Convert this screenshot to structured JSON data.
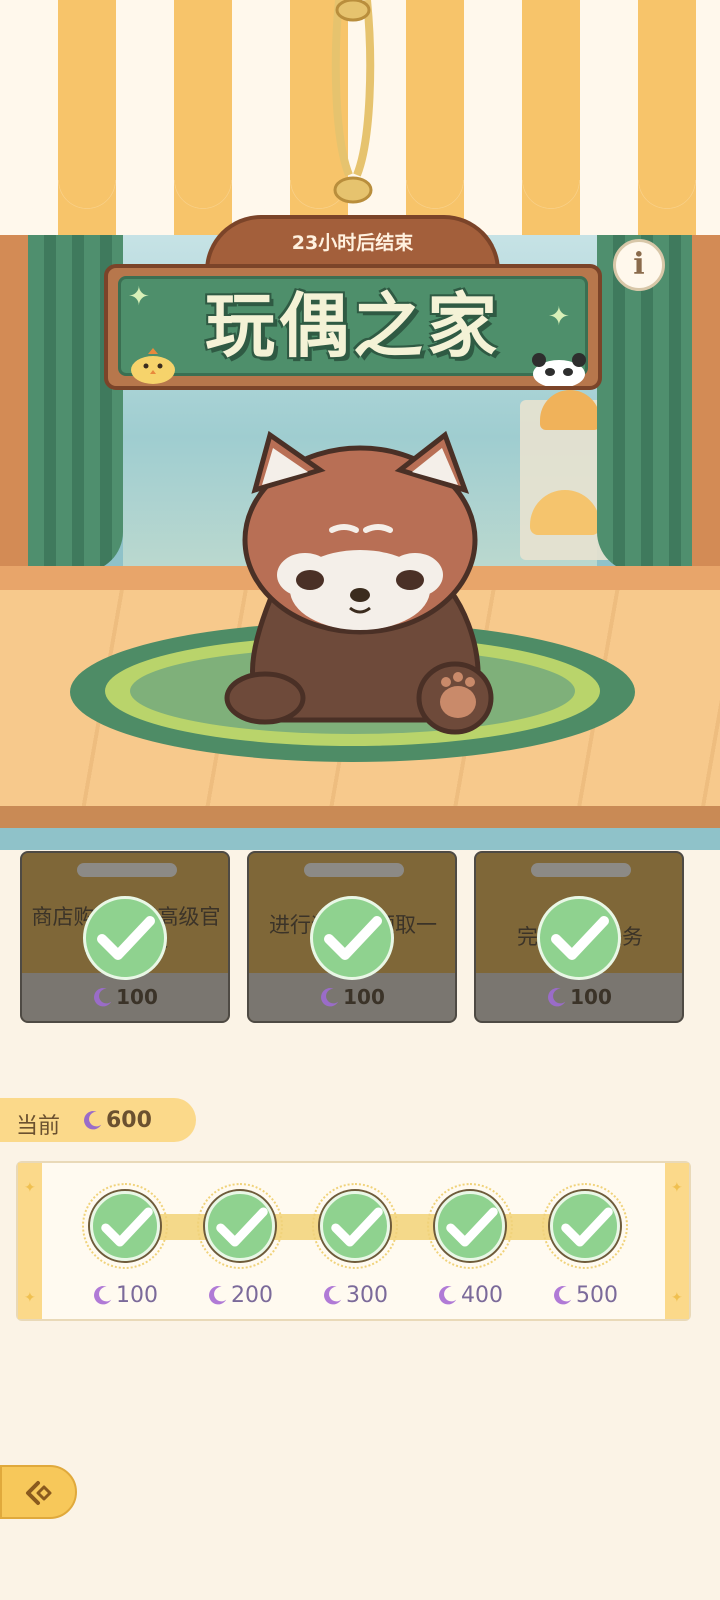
{
  "event": {
    "timer": "23小时后结束",
    "title": "玩偶之家",
    "info_icon": "info-icon"
  },
  "tasks": [
    {
      "text": "商店购买任意高级官方兑换券",
      "reward": "100",
      "completed": true
    },
    {
      "text": "进行装扮并领取一",
      "reward": "100",
      "completed": true
    },
    {
      "text": "完成每日任务",
      "reward": "100",
      "completed": true
    }
  ],
  "progress": {
    "current_label": "当前",
    "current_value": "600",
    "milestones": [
      {
        "value": "100",
        "completed": true
      },
      {
        "value": "200",
        "completed": true
      },
      {
        "value": "300",
        "completed": true
      },
      {
        "value": "400",
        "completed": true
      },
      {
        "value": "500",
        "completed": true
      }
    ]
  },
  "currency_icon": "moon-icon",
  "back_icon": "back-arrow-icon",
  "colors": {
    "check": "#8fd28f",
    "accent": "#fbd98a",
    "board": "#4e8f6b"
  }
}
